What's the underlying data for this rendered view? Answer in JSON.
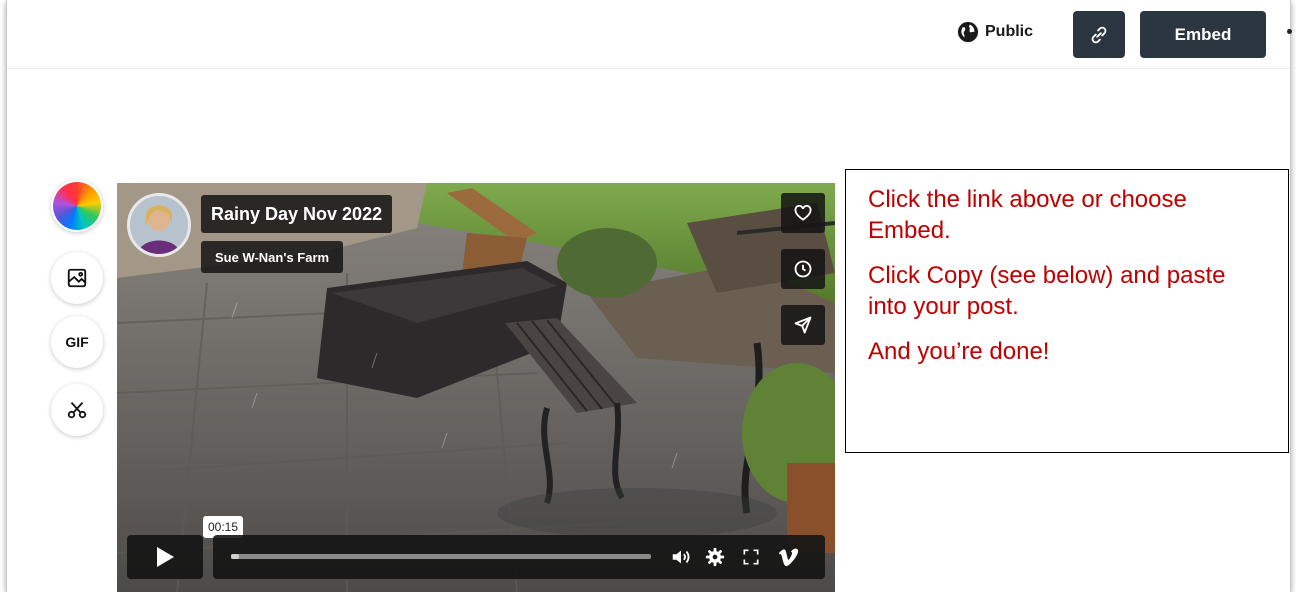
{
  "header": {
    "privacy_label": "Public",
    "embed_label": "Embed"
  },
  "tools": {
    "gif_label": "GIF"
  },
  "video": {
    "title": "Rainy Day Nov 2022",
    "author": "Sue W-Nan's Farm",
    "timestamp": "00:15",
    "progress": 0.02
  },
  "note": {
    "lines": [
      "Click the link above or choose Embed.",
      "Click Copy (see below) and paste into your post.",
      "And you’re done!"
    ],
    "color": "#c00000"
  },
  "colors": {
    "button_bg": "#2b3640",
    "overlay_bg": "#141414"
  }
}
